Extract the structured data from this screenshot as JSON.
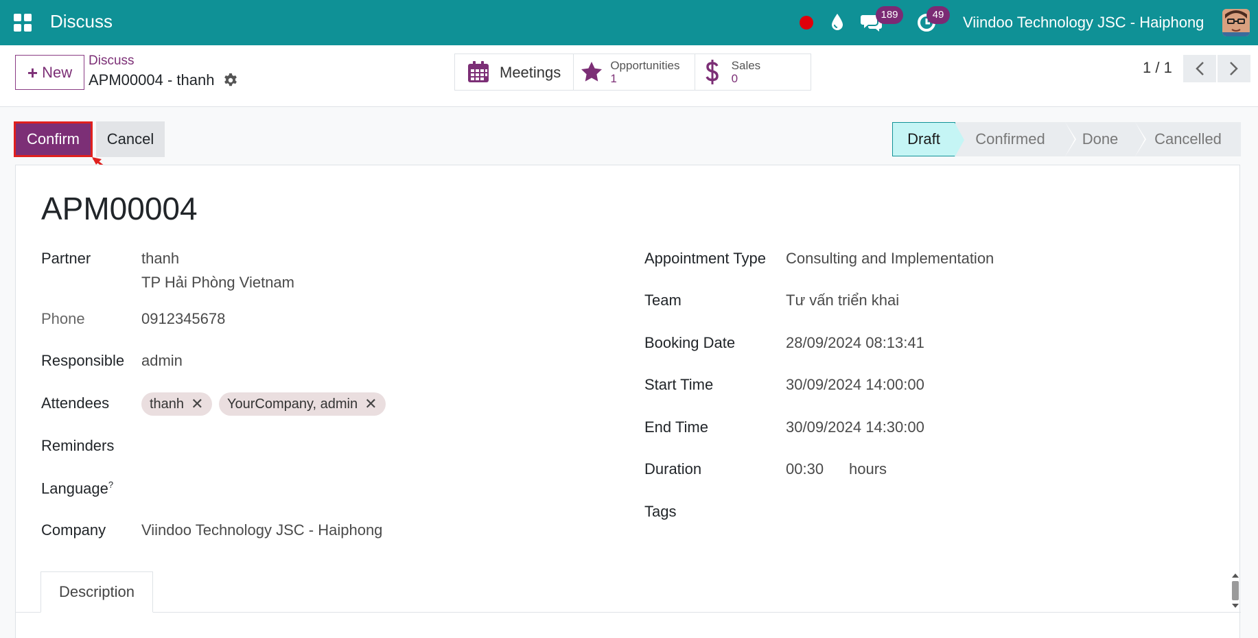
{
  "navbar": {
    "app_title": "Discuss",
    "chat_count": "189",
    "activity_count": "49",
    "company": "Viindoo Technology JSC - Haiphong",
    "colors": {
      "navbar": "#0f9196",
      "badge": "#7b2a74",
      "record": "#e0000a"
    }
  },
  "control": {
    "new_label": "New",
    "breadcrumb_parent": "Discuss",
    "breadcrumb_current": "APM00004 - thanh",
    "smart_buttons": {
      "meetings": {
        "label": "Meetings"
      },
      "opportunities": {
        "label": "Opportunities",
        "value": "1"
      },
      "sales": {
        "label": "Sales",
        "value": "0"
      }
    },
    "pager": "1 / 1"
  },
  "actions": {
    "confirm_label": "Confirm",
    "cancel_label": "Cancel"
  },
  "statusbar": {
    "stages": [
      "Draft",
      "Confirmed",
      "Done",
      "Cancelled"
    ],
    "active": "Draft"
  },
  "form": {
    "title": "APM00004",
    "left": {
      "partner_label": "Partner",
      "partner_name": "thanh",
      "partner_address": "TP Hải Phòng Vietnam",
      "phone_label": "Phone",
      "phone_value": "0912345678",
      "responsible_label": "Responsible",
      "responsible_value": "admin",
      "attendees_label": "Attendees",
      "attendees": [
        "thanh",
        "YourCompany, admin"
      ],
      "reminders_label": "Reminders",
      "language_label": "Language",
      "language_help": "?",
      "company_label": "Company",
      "company_value": "Viindoo Technology JSC - Haiphong"
    },
    "right": {
      "appointment_type_label": "Appointment Type",
      "appointment_type_value": "Consulting and Implementation",
      "team_label": "Team",
      "team_value": "Tư vấn triển khai",
      "booking_date_label": "Booking Date",
      "booking_date_value": "28/09/2024 08:13:41",
      "start_time_label": "Start Time",
      "start_time_value": "30/09/2024 14:00:00",
      "end_time_label": "End Time",
      "end_time_value": "30/09/2024 14:30:00",
      "duration_label": "Duration",
      "duration_value": "00:30",
      "duration_unit": "hours",
      "tags_label": "Tags"
    },
    "tabs": {
      "description": "Description"
    }
  }
}
